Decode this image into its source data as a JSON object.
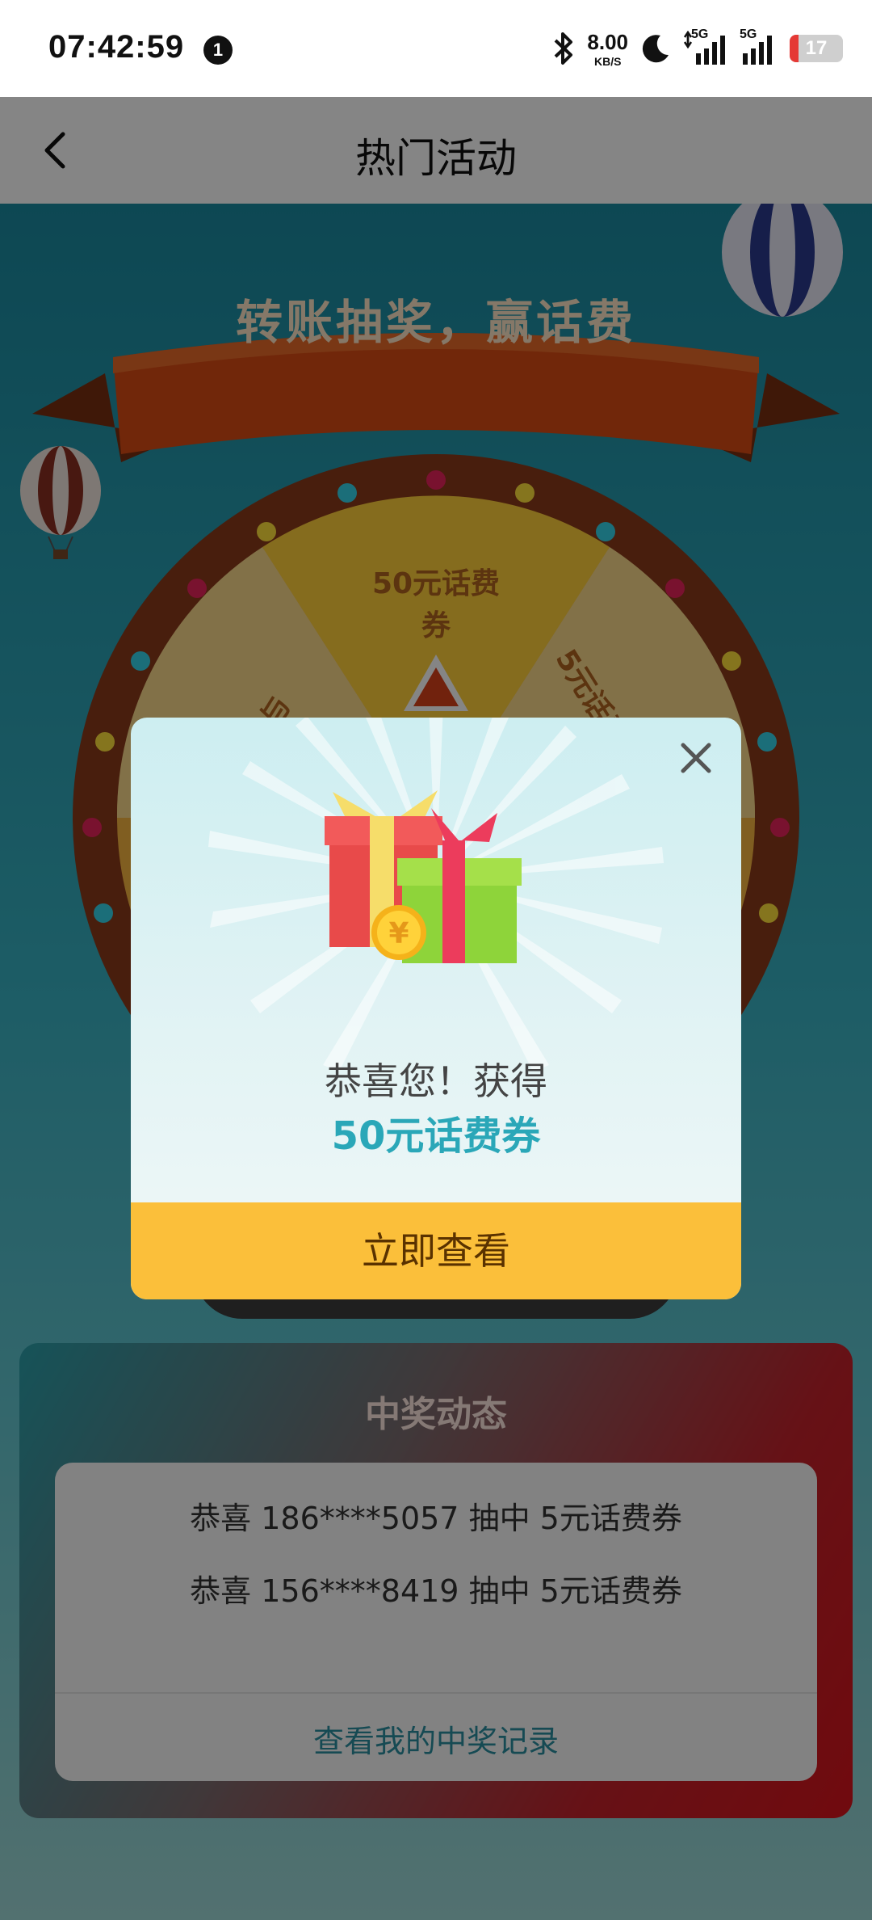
{
  "status_bar": {
    "time": "07:42:59",
    "notification_count": "1",
    "net_speed": "8.00",
    "net_unit": "KB/S",
    "signal_1_label": "5G",
    "signal_2_label": "5G",
    "battery_level": "17",
    "battery_fraction": 0.17
  },
  "navbar": {
    "title": "热门活动"
  },
  "banner": {
    "title": "转账抽奖，赢话费"
  },
  "wheel": {
    "segments": [
      {
        "label": "50元话费券"
      },
      {
        "label": "5元话费券"
      },
      {
        "label": "谢谢参与"
      }
    ]
  },
  "winners": {
    "title": "中奖动态",
    "items": [
      "恭喜 186****5057 抽中 5元话费券",
      "恭喜 156****8419 抽中 5元话费券"
    ],
    "link": "查看我的中奖记录"
  },
  "dialog": {
    "congrats": "恭喜您！获得",
    "prize": "50元话费券",
    "button": "立即查看"
  },
  "colors": {
    "accent_teal": "#2aa7b8",
    "button_yellow": "#fbbf3a",
    "wheel_rim": "#8a3a1a"
  }
}
